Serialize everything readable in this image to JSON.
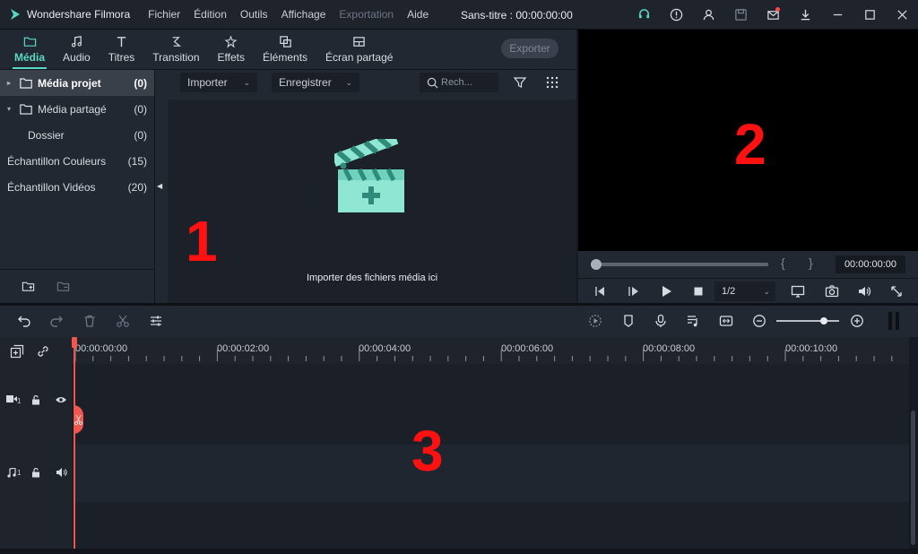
{
  "titlebar": {
    "app_name": "Wondershare Filmora",
    "menu": [
      "Fichier",
      "Édition",
      "Outils",
      "Affichage",
      "Exportation",
      "Aide"
    ],
    "doc_title": "Sans-titre : 00:00:00:00"
  },
  "tabs": [
    {
      "label": "Média",
      "icon": "folder-icon",
      "active": true
    },
    {
      "label": "Audio",
      "icon": "music-note-icon"
    },
    {
      "label": "Titres",
      "icon": "text-t-icon"
    },
    {
      "label": "Transition",
      "icon": "transition-icon"
    },
    {
      "label": "Effets",
      "icon": "effects-icon"
    },
    {
      "label": "Éléments",
      "icon": "elements-icon"
    },
    {
      "label": "Écran partagé",
      "icon": "split-screen-icon"
    }
  ],
  "export_label": "Exporter",
  "tree": [
    {
      "label": "Média projet",
      "count": "(0)",
      "caret": "▸",
      "folder": true
    },
    {
      "label": "Média partagé",
      "count": "(0)",
      "caret": "▾",
      "folder": true
    },
    {
      "label": "Dossier",
      "count": "(0)"
    },
    {
      "label": "Échantillon Couleurs",
      "count": "(15)"
    },
    {
      "label": "Échantillon Vidéos",
      "count": "(20)"
    }
  ],
  "media_toolbar": {
    "import_label": "Importer",
    "record_label": "Enregistrer",
    "search_placeholder": "Rech..."
  },
  "import_hint": "Importer des fichiers média ici",
  "panel_numbers": {
    "media": "1",
    "preview": "2",
    "timeline": "3"
  },
  "preview": {
    "brace_open": "{",
    "brace_close": "}",
    "timecode": "00:00:00:00",
    "ratio": "1/2",
    "progress": 0
  },
  "ruler": {
    "labels": [
      "00:00:00:00",
      "00:00:02:00",
      "00:00:04:00",
      "00:00:06:00",
      "00:00:08:00",
      "00:00:10:00"
    ]
  },
  "tracks": {
    "video_label": "1",
    "audio_label": "1"
  },
  "colors": {
    "accent": "#5ad8c6",
    "playhead": "#f0584f",
    "panel_number": "#ff1111"
  }
}
